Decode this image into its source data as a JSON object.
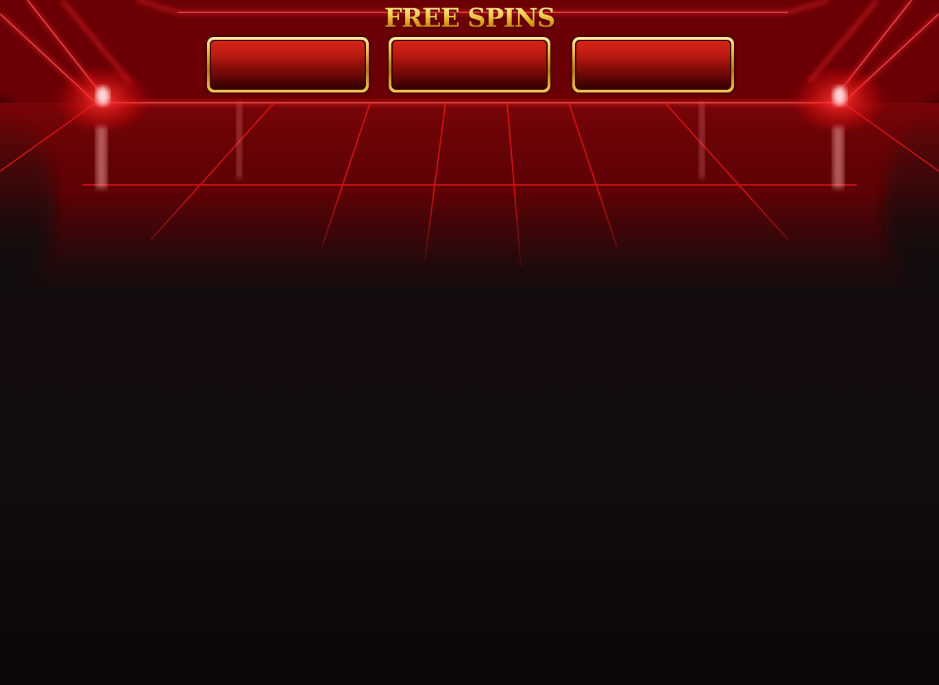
{
  "game": {
    "title": "FREE SPINS",
    "counters": [
      {
        "id": "counter-1",
        "value": ""
      },
      {
        "id": "counter-2",
        "value": ""
      },
      {
        "id": "counter-3",
        "value": ""
      }
    ]
  },
  "colors": {
    "background_top": "#8a0006",
    "background_bottom": "#120c0d",
    "neon_red": "#ff1a1a",
    "gold": "#f3c44a",
    "box_red": "#b81a11"
  }
}
